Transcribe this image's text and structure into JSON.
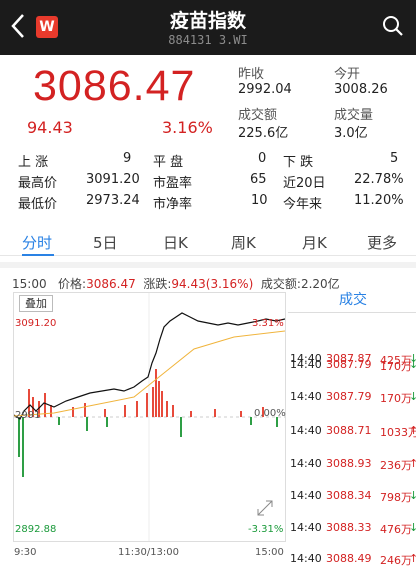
{
  "header": {
    "title": "疫苗指数",
    "code": "884131 3.WI",
    "logo_text": "W",
    "back_icon": "chevron-left-icon",
    "search_icon": "search-icon",
    "bg": "#1b1b1b"
  },
  "quote": {
    "price": "3086.47",
    "change": "94.43",
    "change_pct": "3.16%",
    "prev_close_label": "昨收",
    "prev_close": "2992.04",
    "open_label": "今开",
    "open": "3008.26",
    "turnover_label": "成交额",
    "turnover": "225.6亿",
    "volume_label": "成交量",
    "volume": "3.0亿",
    "accent": "#d32222"
  },
  "stats": [
    {
      "l1": "上  涨",
      "v1": "9",
      "l2": "平  盘",
      "v2": "0",
      "l3": "下  跌",
      "v3": "5"
    },
    {
      "l1": "最高价",
      "v1": "3091.20",
      "l2": "市盈率",
      "v2": "65",
      "l3": "近20日",
      "v3": "22.78%"
    },
    {
      "l1": "最低价",
      "v1": "2973.24",
      "l2": "市净率",
      "v2": "10",
      "l3": "今年来",
      "v3": "11.20%"
    }
  ],
  "tabs": [
    "分时",
    "5日",
    "日K",
    "周K",
    "月K",
    "更多"
  ],
  "chart_header": {
    "time": "15:00",
    "price_label": "价格:",
    "price": "3086.47",
    "chg_label": "涨跌:",
    "chg": "94.43(3.16%)",
    "amt_label": "成交额:",
    "amt": "2.20亿"
  },
  "overlay_label": "叠加",
  "axis": {
    "top_price": "3091.20",
    "top_pct": "3.31%",
    "mid_price": "2991",
    "mid_pct": "0.00%",
    "bottom_price": "2892.88",
    "bottom_pct": "-3.31%",
    "times": [
      "9:30",
      "11:30/13:00",
      "15:00"
    ]
  },
  "trade_title": "成交",
  "trades": [
    {
      "time": "14:40",
      "price": "3087.87",
      "vol": "425万",
      "dir": "↓"
    },
    {
      "time": "14:40",
      "price": "3087.79",
      "vol": "170万",
      "dir": "↓"
    },
    {
      "time": "14:40",
      "price": "3087.79",
      "vol": "170万",
      "dir": "↓"
    },
    {
      "time": "14:40",
      "price": "3088.71",
      "vol": "1033万",
      "dir": "↑"
    },
    {
      "time": "14:40",
      "price": "3088.93",
      "vol": "236万",
      "dir": "↑"
    },
    {
      "time": "14:40",
      "price": "3088.34",
      "vol": "798万",
      "dir": "↓"
    },
    {
      "time": "14:40",
      "price": "3088.33",
      "vol": "476万",
      "dir": "↓"
    },
    {
      "time": "14:40",
      "price": "3088.49",
      "vol": "246万",
      "dir": "↑"
    }
  ]
}
